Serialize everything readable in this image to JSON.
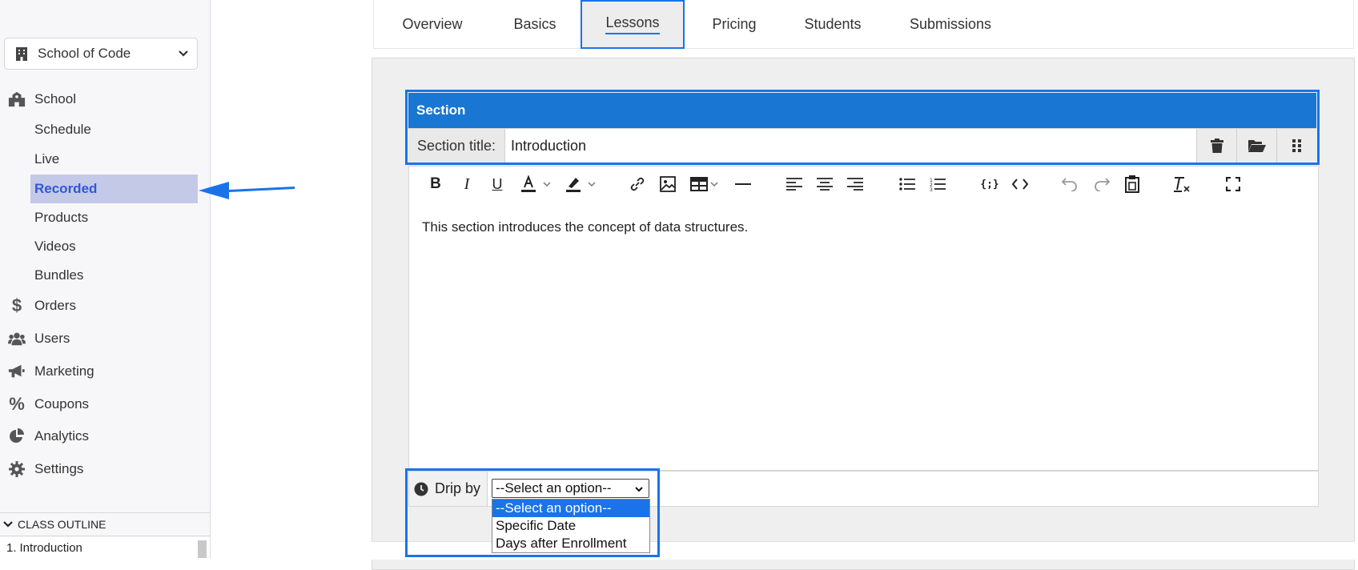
{
  "sidebar": {
    "school_selector": "School of Code",
    "items": [
      {
        "label": "School",
        "icon": "school-icon"
      },
      {
        "label": "Orders",
        "icon": "dollar-icon"
      },
      {
        "label": "Users",
        "icon": "users-icon"
      },
      {
        "label": "Marketing",
        "icon": "megaphone-icon"
      },
      {
        "label": "Coupons",
        "icon": "percent-icon"
      },
      {
        "label": "Analytics",
        "icon": "pie-chart-icon"
      },
      {
        "label": "Settings",
        "icon": "gear-icon"
      }
    ],
    "school_sub_items": [
      "Schedule",
      "Live",
      "Recorded",
      "Products",
      "Videos",
      "Bundles"
    ],
    "active_sub_item": "Recorded",
    "class_outline": {
      "header": "CLASS OUTLINE",
      "items": [
        {
          "number": "1.",
          "label": "Introduction"
        }
      ]
    }
  },
  "tabs": [
    {
      "label": "Overview"
    },
    {
      "label": "Basics"
    },
    {
      "label": "Lessons"
    },
    {
      "label": "Pricing"
    },
    {
      "label": "Students"
    },
    {
      "label": "Submissions"
    }
  ],
  "active_tab": "Lessons",
  "section": {
    "header": "Section",
    "title_label": "Section title:",
    "title_value": "Introduction",
    "body_text": "This section introduces the concept of data structures."
  },
  "drip": {
    "label": "Drip by",
    "selected": "--Select an option--",
    "options": [
      "--Select an option--",
      "Specific Date",
      "Days after Enrollment"
    ]
  },
  "colors": {
    "accent": "#1a73e8",
    "section_header": "#1976d2",
    "active_nav_bg": "#c5c9e8",
    "active_nav_text": "#2f58d6"
  }
}
